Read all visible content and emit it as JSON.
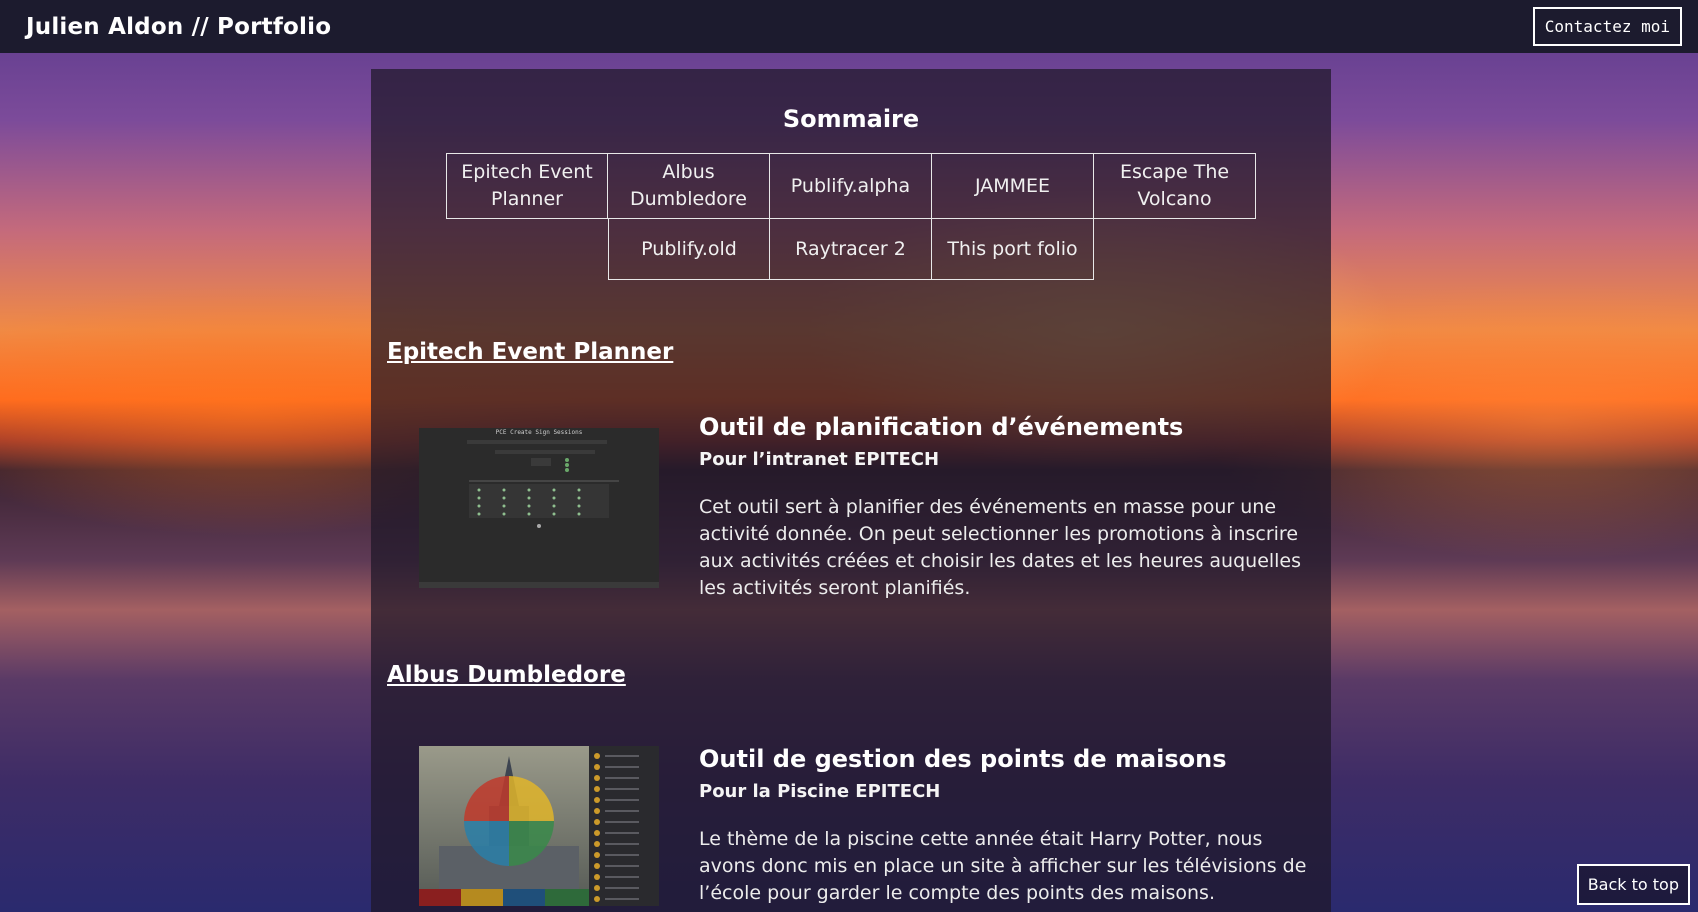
{
  "header": {
    "title": "Julien Aldon // Portfolio",
    "contact_label": "Contactez moi"
  },
  "sommaire": {
    "title": "Sommaire",
    "items": [
      "Epitech Event Planner",
      "Albus Dumbledore",
      "Publify.alpha",
      "JAMMEE",
      "Escape The Volcano",
      "Publify.old",
      "Raytracer 2",
      "This port folio"
    ]
  },
  "projects": [
    {
      "heading": "Epitech Event Planner",
      "title": "Outil de planification d’événements",
      "subtitle": "Pour l’intranet EPITECH",
      "description": "Cet outil sert à planifier des événements en masse pour une activité donnée. On peut selectionner les promotions à inscrire aux activités créées et choisir les dates et les heures auquelles les activités seront planifiés.",
      "screenshot_title": "PCE Create Sign Sessions"
    },
    {
      "heading": "Albus Dumbledore",
      "title": "Outil de gestion des points de maisons",
      "subtitle": "Pour la Piscine EPITECH",
      "description": "Le thème de la piscine cette année était Harry Potter, nous avons donc mis en place un site à afficher sur les télévisions de l’école pour garder le compte des points des maisons."
    }
  ],
  "back_to_top_label": "Back to top",
  "colors": {
    "topbar": "#1c1b2e",
    "panel": "rgba(30,24,40,0.72)",
    "text": "#ffffff",
    "house_red": "#c0392b",
    "house_yellow": "#e0b52a",
    "house_blue": "#2a7fa8",
    "house_green": "#3a8a4a"
  }
}
